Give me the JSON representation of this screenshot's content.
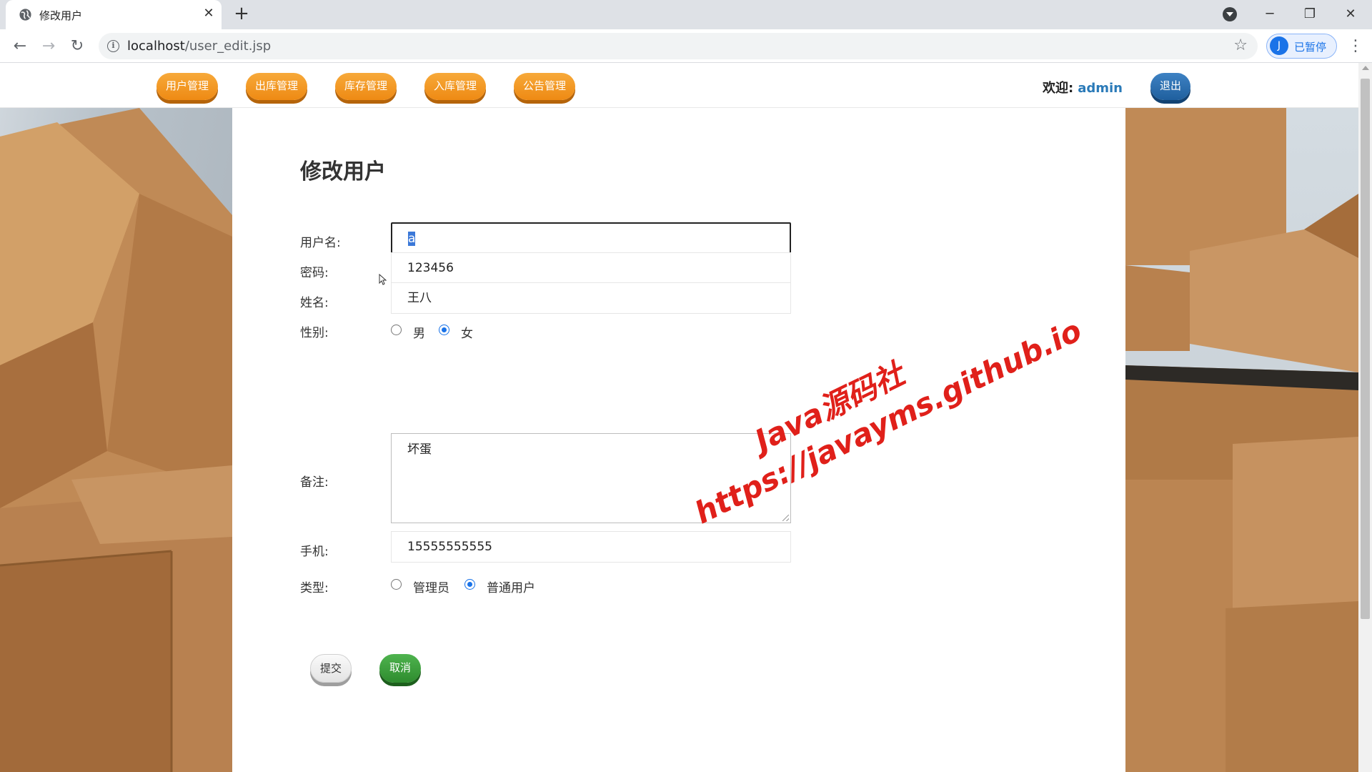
{
  "browser": {
    "tab_title": "修改用户",
    "tab_close": "✕",
    "new_tab": "+",
    "url_host": "localhost",
    "url_path": "/user_edit.jsp",
    "profile_initial": "J",
    "profile_label": "已暂停"
  },
  "nav": {
    "items": [
      "用户管理",
      "出库管理",
      "库存管理",
      "入库管理",
      "公告管理"
    ],
    "welcome_label": "欢迎:",
    "username": "admin",
    "logout": "退出"
  },
  "form": {
    "title": "修改用户",
    "username_label": "用户名:",
    "username_value": "a",
    "password_label": "密码:",
    "password_value": "123456",
    "name_label": "姓名:",
    "name_value": "王八",
    "gender_label": "性别:",
    "gender_options": [
      "男",
      "女"
    ],
    "gender_selected": "女",
    "remark_label": "备注:",
    "remark_value": "坏蛋",
    "phone_label": "手机:",
    "phone_value": "15555555555",
    "type_label": "类型:",
    "type_options": [
      "管理员",
      "普通用户"
    ],
    "type_selected": "普通用户",
    "submit": "提交",
    "cancel": "取消"
  },
  "watermark": {
    "line1": "Java源码社",
    "line2": "https://javayms.github.io"
  },
  "colors": {
    "nav_orange": "#f09418",
    "logout_blue": "#2a6aa8",
    "cancel_green": "#3a9a3a",
    "watermark_red": "#e0201a"
  }
}
